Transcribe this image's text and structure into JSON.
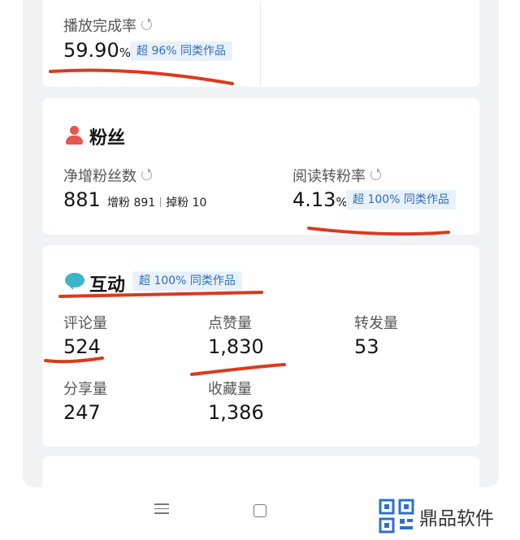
{
  "completion": {
    "label": "播放完成率",
    "value": "59.90",
    "unit": "%",
    "badge": "超 96% 同类作品"
  },
  "fans": {
    "title": "粉丝",
    "net_label": "净增粉丝数",
    "net_value": "881",
    "gain_label": "增粉",
    "gain_value": "891",
    "loss_label": "掉粉",
    "loss_value": "10",
    "rate_label": "阅读转粉率",
    "rate_value": "4.13",
    "rate_unit": "%",
    "rate_badge": "超 100% 同类作品"
  },
  "interaction": {
    "title": "互动",
    "badge": "超 100% 同类作品",
    "stats": [
      {
        "label": "评论量",
        "value": "524"
      },
      {
        "label": "点赞量",
        "value": "1,830"
      },
      {
        "label": "转发量",
        "value": "53"
      },
      {
        "label": "分享量",
        "value": "247"
      },
      {
        "label": "收藏量",
        "value": "1,386"
      }
    ]
  },
  "watermark": {
    "text": "鼎品软件"
  },
  "colors": {
    "badge_bg": "#e8f1fb",
    "badge_text": "#2f6fb5",
    "annotation_red": "#d93a1d",
    "fans_icon": "#e8544f",
    "interaction_icon": "#3cb6c7"
  }
}
